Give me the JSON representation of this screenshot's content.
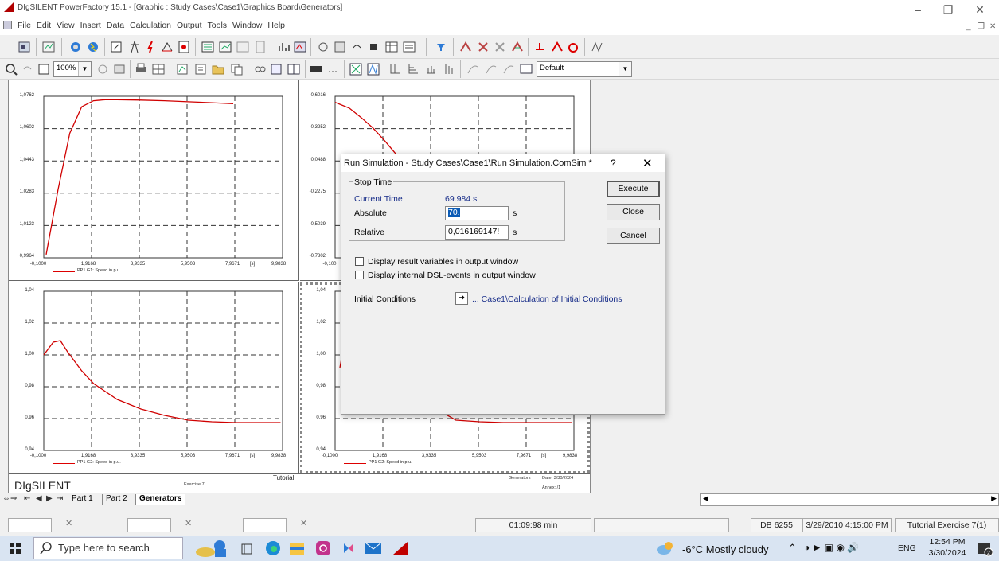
{
  "app": {
    "title": "DIgSILENT PowerFactory 15.1 - [Graphic : Study Cases\\Case1\\Graphics Board\\Generators]",
    "menu": [
      "File",
      "Edit",
      "View",
      "Insert",
      "Data",
      "Calculation",
      "Output",
      "Tools",
      "Window",
      "Help"
    ]
  },
  "toolbar2": {
    "zoom": "100%",
    "default_combo": "Default"
  },
  "plots": [
    {
      "id": "p1",
      "y_ticks": [
        "1,0762",
        "1,0602",
        "1,0443",
        "1,0283",
        "1,0123",
        "0,9964"
      ],
      "x_ticks": [
        "-0,1000",
        "1,9168",
        "3,9335",
        "5,9503",
        "7,9671",
        "[s]",
        "9,9838"
      ],
      "legend": "PP1 G1: Speed in p.u.",
      "chart_data": {
        "type": "line",
        "x": [
          0,
          0.5,
          1,
          1.5,
          2,
          2.5,
          3,
          4,
          5,
          6,
          7,
          7.9
        ],
        "y": [
          0.998,
          1.03,
          1.058,
          1.071,
          1.074,
          1.0745,
          1.0745,
          1.0743,
          1.074,
          1.0735,
          1.073,
          1.0725
        ],
        "xlim": [
          -0.1,
          9.9838
        ],
        "ylim": [
          0.9964,
          1.0762
        ]
      }
    },
    {
      "id": "p2",
      "y_ticks": [
        "0,6016",
        "0,3252",
        "0,0488",
        "-0,2275",
        "-0,5039",
        "-0,7802"
      ],
      "x_ticks": [
        "-0,100"
      ],
      "legend": "",
      "chart_data": {
        "type": "line",
        "x": [
          -0.1,
          0.5,
          1,
          1.5,
          2,
          2.5
        ],
        "y": [
          0.55,
          0.5,
          0.42,
          0.33,
          0.22,
          0.1
        ],
        "xlim": [
          -0.1,
          9.9838
        ],
        "ylim": [
          -0.7802,
          0.6016
        ]
      }
    },
    {
      "id": "p3",
      "y_ticks": [
        "1,04",
        "1,02",
        "1,00",
        "0,98",
        "0,96",
        "0,94"
      ],
      "x_ticks": [
        "-0,1000",
        "1,9168",
        "3,9335",
        "5,9503",
        "7,9671",
        "[s]",
        "9,9838"
      ],
      "legend": "PP1 G2: Speed in p.u.",
      "chart_data": {
        "type": "line",
        "x": [
          -0.1,
          0.3,
          0.6,
          0.9,
          1.5,
          2,
          3,
          4,
          5,
          6,
          7,
          8,
          9.9
        ],
        "y": [
          1.0,
          1.008,
          1.009,
          1.002,
          0.99,
          0.982,
          0.972,
          0.966,
          0.962,
          0.959,
          0.958,
          0.9575,
          0.9575
        ],
        "xlim": [
          -0.1,
          9.9838
        ],
        "ylim": [
          0.94,
          1.04
        ]
      }
    },
    {
      "id": "p4",
      "y_ticks": [
        "1,04",
        "1,02",
        "1,00",
        "0,98",
        "0,96",
        "0,94"
      ],
      "x_ticks": [
        "-0,1000",
        "1,9168",
        "3,9335",
        "5,9503",
        "7,9671",
        "[s]",
        "9,9838"
      ],
      "legend": "PP1 G2: Speed in p.u.",
      "chart_data": {
        "type": "line",
        "x": [
          0.1,
          0.2,
          5,
          6,
          7,
          8,
          9.9
        ],
        "y": [
          0.992,
          1.0,
          0.959,
          0.958,
          0.9575,
          0.9575,
          0.9575
        ],
        "xlim": [
          -0.1,
          9.9838
        ],
        "ylim": [
          0.94,
          1.04
        ]
      }
    }
  ],
  "footer": {
    "brand": "DIgSILENT",
    "exercise": "Exercise 7",
    "tutorial": "Tutorial",
    "generators": "Generators",
    "date": "Date: 3/30/2024",
    "annex": "Annex: /1"
  },
  "tabs": [
    "Part 1",
    "Part 2",
    "Generators"
  ],
  "dialog": {
    "title": "Run Simulation - Study Cases\\Case1\\Run Simulation.ComSim *",
    "help": "?",
    "close_x": "✕",
    "group": "Stop Time",
    "current_time_label": "Current Time",
    "current_time_value": "69.984 s",
    "absolute_label": "Absolute",
    "absolute_value": "70.",
    "absolute_unit": "s",
    "relative_label": "Relative",
    "relative_value": "0,016169147!",
    "relative_unit": "s",
    "execute": "Execute",
    "close": "Close",
    "cancel": "Cancel",
    "chk1": "Display result variables in output window",
    "chk2": "Display internal DSL-events in output window",
    "initial_label": "Initial Conditions",
    "initial_value": "... Case1\\Calculation of Initial Conditions"
  },
  "status": {
    "time": "01:09:98 min",
    "db": "DB 6255",
    "date": "3/29/2010 4:15:00 PM",
    "tutorial": "Tutorial Exercise 7(1)"
  },
  "taskbar": {
    "search": "Type here to search",
    "weather": "-6°C  Mostly cloudy",
    "lang": "ENG",
    "clock_time": "12:54 PM",
    "clock_date": "3/30/2024",
    "notif": "2"
  },
  "colors": {
    "curve": "#d00000",
    "accent": "#0b5bb5"
  }
}
